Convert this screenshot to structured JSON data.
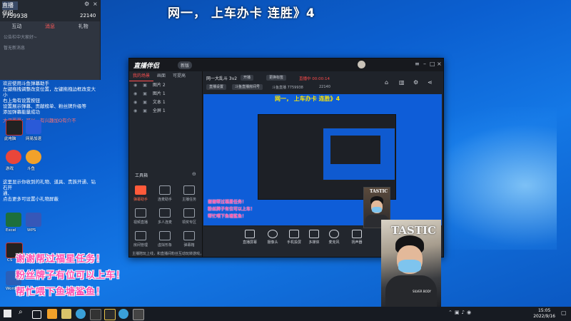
{
  "overlay_title": "网一，  上车办卡 连胜》4",
  "left_panel": {
    "logo": "直播伴侣",
    "user_id": "7759938",
    "likes": "22140",
    "tabs": [
      "互动",
      "消息",
      "礼物"
    ],
    "hint1": "公告栏中大家好~",
    "hint2": "暂无新消息",
    "messages": [
      {
        "text": "欢迎使用斗鱼弹幕助手",
        "red": false
      },
      {
        "text": "左键拖拽调整改变位置，左键拖拽边框改变大小",
        "red": false
      },
      {
        "text": "右上角有设置按钮",
        "red": false
      },
      {
        "text": "设置展示弹幕、贡献榜单、粉丝牌升级等",
        "red": false
      },
      {
        "text": "添加弹幕能量成功",
        "red": false
      },
      {
        "text": "大叔哥哥：可以，有兴趣加Q有介不",
        "red": true
      },
      {
        "text": "这里显示你收到的礼物、道具、贵族开通、钻石开",
        "red": false
      },
      {
        "text": "通、",
        "red": false
      },
      {
        "text": "点击更多可设置小礼物屏蔽",
        "red": false
      }
    ]
  },
  "app": {
    "brand": "直播伴侣",
    "version": "新版",
    "side_tabs": [
      "我的场景",
      "画面",
      "可提高"
    ],
    "sources": [
      {
        "name": "图片 2"
      },
      {
        "name": "图片 1"
      },
      {
        "name": "文本 1"
      },
      {
        "name": "全屏 1"
      }
    ],
    "tools_header": "工具箱",
    "tools": [
      {
        "label": "弹幕助手",
        "hot": true
      },
      {
        "label": "连麦助手",
        "hot": false
      },
      {
        "label": "主播任务",
        "hot": false
      },
      {
        "label": "视频直播",
        "hot": false
      },
      {
        "label": "多人连麦",
        "hot": false
      },
      {
        "label": "领奖专区",
        "hot": false
      },
      {
        "label": "房间管理",
        "hot": false
      },
      {
        "label": "虚拟形象",
        "hot": false
      },
      {
        "label": "弹幕箱",
        "hot": false
      }
    ],
    "notice": "主播陪玩上线，和直播间粉丝互动玩转游戏，进位游戏分类与你交流中",
    "stream_title": "网一大乱斗 3v2",
    "chip_a": "开播",
    "chip_b": "更换标签",
    "live_status": "直播中 00:00:14",
    "chip_c": "直播设置",
    "chip_d": "斗鱼直播房间号",
    "room_label": "斗鱼直播 7759938",
    "room_likes": "22140",
    "preview_title": "网一，  上车办卡 连胜》4",
    "preview_comments": [
      "谢谢帮过福星任务！",
      "粉丝牌子有位可以上车！",
      "帮忙喂下鱼塘鲨鱼！"
    ],
    "bottom_tools": [
      {
        "label": "直播屏幕"
      },
      {
        "label": "摄像头"
      },
      {
        "label": "手机投屏"
      },
      {
        "label": "多媒体"
      },
      {
        "label": "麦克风"
      },
      {
        "label": "扬声器"
      }
    ]
  },
  "big_comments": [
    "谢谢帮过福星任务！",
    "粉丝牌子有位可以上车！",
    "帮忙喂下鱼塘鲨鱼！"
  ],
  "cam_text_1": "TASTIC",
  "cam_text_2": "TASTIC",
  "cam_caption": "SILVER BODY",
  "clock": {
    "time": "15:05",
    "date": "2022/9/16"
  },
  "desktop_icons": [
    {
      "label": "此电脑"
    },
    {
      "label": "网易加速"
    },
    {
      "label": "游戏"
    },
    {
      "label": "斗鱼"
    },
    {
      "label": "Excel"
    },
    {
      "label": "WPS"
    },
    {
      "label": "CS"
    },
    {
      "label": "Word"
    }
  ]
}
